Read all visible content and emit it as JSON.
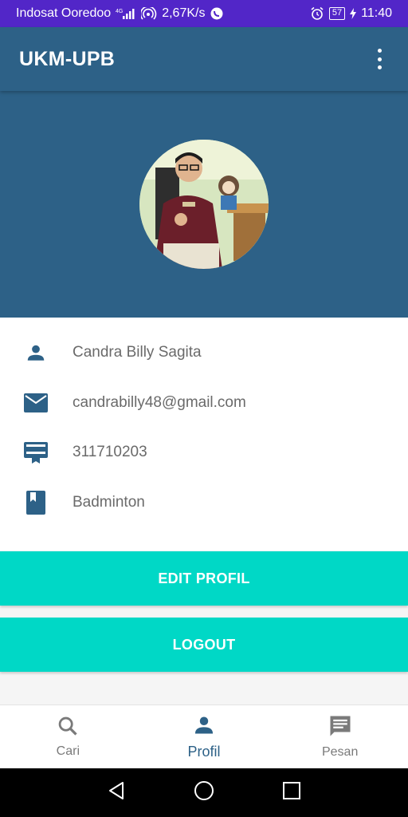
{
  "status_bar": {
    "carrier": "Indosat Ooredoo",
    "network": "4G",
    "speed": "2,67K/s",
    "battery": "57",
    "time": "11:40"
  },
  "app_bar": {
    "title": "UKM-UPB",
    "menu_icon": "more-vert-icon"
  },
  "profile": {
    "name": "Candra Billy Sagita",
    "email": "candrabilly48@gmail.com",
    "id_number": "311710203",
    "activity": "Badminton"
  },
  "buttons": {
    "edit_label": "EDIT PROFIL",
    "logout_label": "LOGOUT"
  },
  "bottom_nav": {
    "items": [
      {
        "label": "Cari",
        "icon": "search-icon",
        "active": false
      },
      {
        "label": "Profil",
        "icon": "person-icon",
        "active": true
      },
      {
        "label": "Pesan",
        "icon": "message-icon",
        "active": false
      }
    ]
  },
  "colors": {
    "primary": "#2d6187",
    "accent": "#00d8c6",
    "status_bar": "#5226c8"
  }
}
